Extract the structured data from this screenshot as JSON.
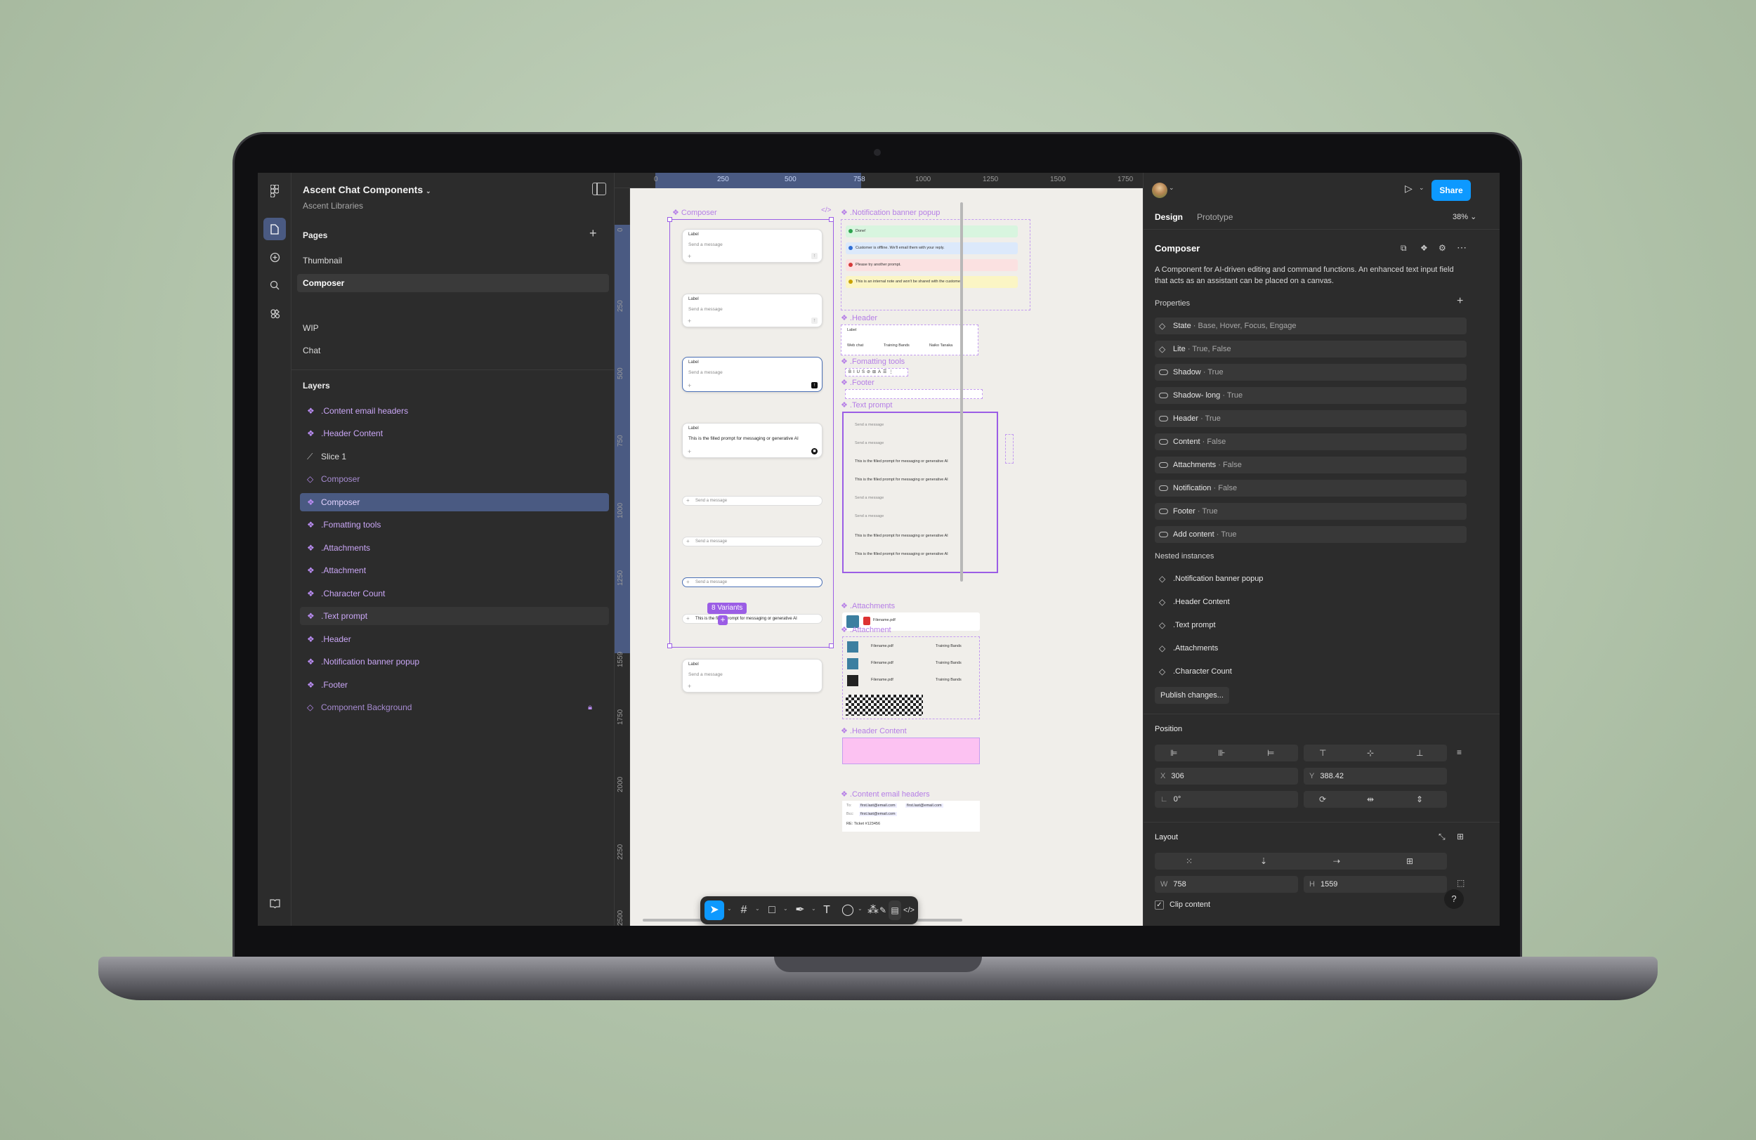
{
  "file": {
    "title": "Ascent Chat Components",
    "library": "Ascent Libraries"
  },
  "pages": {
    "heading": "Pages",
    "items": [
      "Thumbnail",
      "Composer",
      "WIP",
      "Chat"
    ],
    "selected": "Composer"
  },
  "layers": {
    "heading": "Layers",
    "items": [
      {
        "label": ".Content email headers",
        "icon": "component-icon"
      },
      {
        "label": ".Header Content",
        "icon": "component-icon"
      },
      {
        "label": "Slice 1",
        "icon": "slice-icon"
      },
      {
        "label": "Composer",
        "icon": "component-set-icon"
      },
      {
        "label": "Composer",
        "icon": "component-icon",
        "selected": true
      },
      {
        "label": ".Fomatting tools",
        "icon": "component-icon"
      },
      {
        "label": ".Attachments",
        "icon": "component-icon"
      },
      {
        "label": ".Attachment",
        "icon": "component-icon"
      },
      {
        "label": ".Character Count",
        "icon": "component-icon"
      },
      {
        "label": ".Text prompt",
        "icon": "component-icon"
      },
      {
        "label": ".Header",
        "icon": "component-icon"
      },
      {
        "label": ".Notification banner popup",
        "icon": "component-icon"
      },
      {
        "label": ".Footer",
        "icon": "component-icon"
      },
      {
        "label": "Component Background",
        "icon": "component-set-icon",
        "locked": true
      }
    ]
  },
  "rulers": {
    "top": [
      "0",
      "250",
      "500",
      "758",
      "1000",
      "1250",
      "1500",
      "1750"
    ],
    "left": [
      "0",
      "250",
      "500",
      "750",
      "1000",
      "1250",
      "1559",
      "1750",
      "2000",
      "2250",
      "2500"
    ]
  },
  "canvas": {
    "frames": {
      "composer": "Composer",
      "notification": ".Notification banner popup",
      "header": ".Header",
      "formatting": ".Fomatting tools",
      "footer": ".Footer",
      "text_prompt": ".Text prompt",
      "attachments": ".Attachments",
      "attachment": ".Attachment",
      "header_content": ".Header Content",
      "content_email": ".Content email headers"
    },
    "composer_label": "Label",
    "placeholder": "Send a message",
    "filled_prompt": "This is the filled prompt for messaging or generative AI",
    "variants_badge": "8 Variants",
    "notifications": [
      "Done!",
      "Customer is offline. We'll email them with your reply.",
      "Please try another prompt.",
      "This is an internal note and won't be shared with the customer."
    ],
    "header_tags": [
      "Web chat",
      "Training Bands",
      "Naiko Tanaka"
    ],
    "file_name": "Filename.pdf",
    "file_name_2": "Training Bands",
    "email": {
      "to": "To:",
      "bcc": "Bcc:",
      "addr": "first.last@email.com",
      "ticket": "RE: Ticket #123456"
    }
  },
  "right": {
    "tabs": [
      "Design",
      "Prototype"
    ],
    "zoom": "38%",
    "share": "Share",
    "component_name": "Composer",
    "description": "A Component for AI-driven editing and command functions. An enhanced text input field that acts as an assistant can be placed on a canvas.",
    "properties_heading": "Properties",
    "properties": [
      {
        "name": "State",
        "value": "Base, Hover, Focus, Engage",
        "kind": "variant"
      },
      {
        "name": "Lite",
        "value": "True, False",
        "kind": "variant"
      },
      {
        "name": "Shadow",
        "value": "True",
        "kind": "boolean"
      },
      {
        "name": "Shadow- long",
        "value": "True",
        "kind": "boolean"
      },
      {
        "name": "Header",
        "value": "True",
        "kind": "boolean"
      },
      {
        "name": "Content",
        "value": "False",
        "kind": "boolean"
      },
      {
        "name": "Attachments",
        "value": "False",
        "kind": "boolean"
      },
      {
        "name": "Notification",
        "value": "False",
        "kind": "boolean"
      },
      {
        "name": "Footer",
        "value": "True",
        "kind": "boolean"
      },
      {
        "name": "Add content",
        "value": "True",
        "kind": "boolean"
      }
    ],
    "nested_heading": "Nested instances",
    "nested": [
      ".Notification banner popup",
      ".Header Content",
      ".Text prompt",
      ".Attachments",
      ".Character Count"
    ],
    "publish": "Publish changes...",
    "position_heading": "Position",
    "x_label": "X",
    "x": "306",
    "y_label": "Y",
    "y": "388.42",
    "rotation": "0°",
    "layout_heading": "Layout",
    "w_label": "W",
    "w": "758",
    "h_label": "H",
    "h": "1559",
    "clip": "Clip content"
  }
}
